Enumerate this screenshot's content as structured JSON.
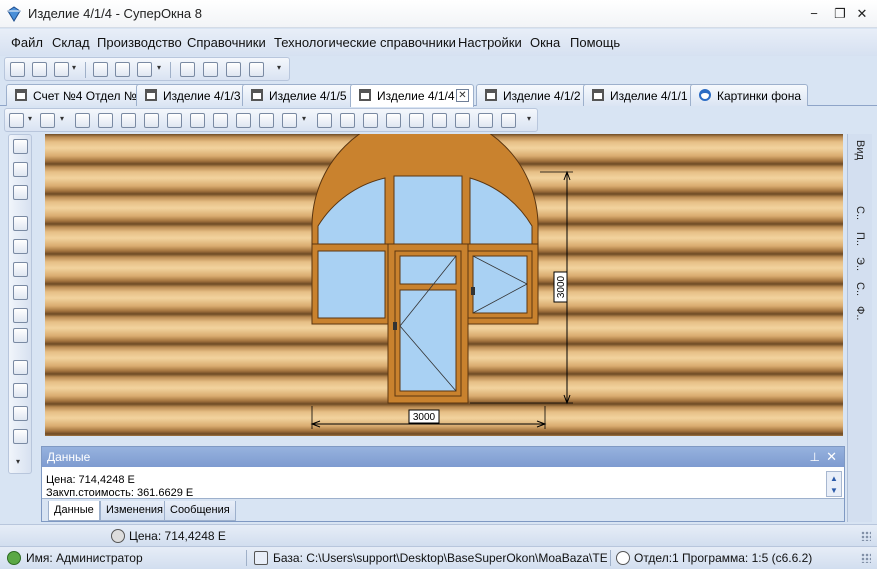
{
  "window": {
    "title": "Изделие 4/1/4 - СуперОкна 8",
    "controls": {
      "minimize": "−",
      "restore": "❐",
      "close": "✕"
    }
  },
  "menu": [
    "Файл",
    "Склад",
    "Производство",
    "Справочники",
    "Технологические справочники",
    "Настройки",
    "Окна",
    "Помощь"
  ],
  "tabs": [
    {
      "label": "Счет №4 Отдел №1",
      "active": false
    },
    {
      "label": "Изделие 4/1/3",
      "active": false
    },
    {
      "label": "Изделие 4/1/5",
      "active": false
    },
    {
      "label": "Изделие 4/1/4",
      "active": true,
      "close": "✕"
    },
    {
      "label": "Изделие 4/1/2",
      "active": false
    },
    {
      "label": "Изделие 4/1/1",
      "active": false
    },
    {
      "label": "Картинки фона",
      "active": false
    }
  ],
  "drawing": {
    "width_dim": "3000",
    "height_dim": "3000"
  },
  "right_panel": {
    "items": [
      "Вид",
      "С..",
      "П..",
      "Э..",
      "С..",
      "Ф.."
    ]
  },
  "data_panel": {
    "title": "Данные",
    "pin": "⊥",
    "close": "✕",
    "lines": [
      "Цена: 714,4248 Е",
      "Закуп.стоимость: 361,6629 Е"
    ],
    "tabs": [
      "Данные",
      "Изменения",
      "Сообщения"
    ],
    "scroll_up": "▲",
    "scroll_down": "▼"
  },
  "status1": {
    "price": "Цена: 714,4248 Е"
  },
  "status2": {
    "user": "Имя: Администратор",
    "base": "База: C:\\Users\\support\\Desktop\\BaseSuperOkon\\MoaBaza\\TEST.F",
    "program": "Отдел:1 Программа: 1:5 (с6.6.2)"
  },
  "colors": {
    "frame": "#c9822e",
    "glass": "#a9d1f3",
    "accent": "#2b579a"
  }
}
